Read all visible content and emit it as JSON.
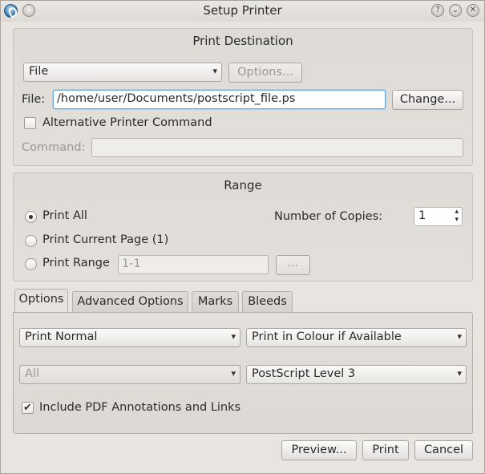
{
  "window": {
    "title": "Setup Printer"
  },
  "titlebar": {
    "help_glyph": "?",
    "minimize_glyph": "⌄",
    "close_glyph": "✕"
  },
  "destination": {
    "group_title": "Print Destination",
    "printer_select": "File",
    "options_label": "Options...",
    "file_label": "File:",
    "file_value": "/home/user/Documents/postscript_file.ps",
    "change_label": "Change...",
    "alt_cmd_label": "Alternative Printer Command",
    "alt_cmd_checked": false,
    "command_label": "Command:",
    "command_value": ""
  },
  "range": {
    "group_title": "Range",
    "print_all": "Print All",
    "print_current": "Print Current Page (1)",
    "print_range": "Print Range",
    "range_value": "1-1",
    "range_btn": "...",
    "selected": "print_all",
    "copies_label": "Number of Copies:",
    "copies_value": "1"
  },
  "tabs": [
    {
      "label": "Options",
      "active": true
    },
    {
      "label": "Advanced Options",
      "active": false
    },
    {
      "label": "Marks",
      "active": false
    },
    {
      "label": "Bleeds",
      "active": false
    }
  ],
  "options": {
    "print_mode": "Print Normal",
    "color_mode": "Print in Colour if Available",
    "separation": "All",
    "postscript_level": "PostScript Level 3",
    "pdf_annotations_label": "Include PDF Annotations and Links",
    "pdf_annotations_checked": true
  },
  "footer": {
    "preview_label": "Preview...",
    "print_label": "Print",
    "cancel_label": "Cancel"
  },
  "icons": [
    "app-icon",
    "help-icon",
    "minimize-icon",
    "close-icon",
    "chevron-down-icon",
    "checkmark-icon",
    "spin-arrows-icon"
  ],
  "colors": {
    "focus_border": "#6aa9d9",
    "window_bg": "#e8e5e1"
  }
}
